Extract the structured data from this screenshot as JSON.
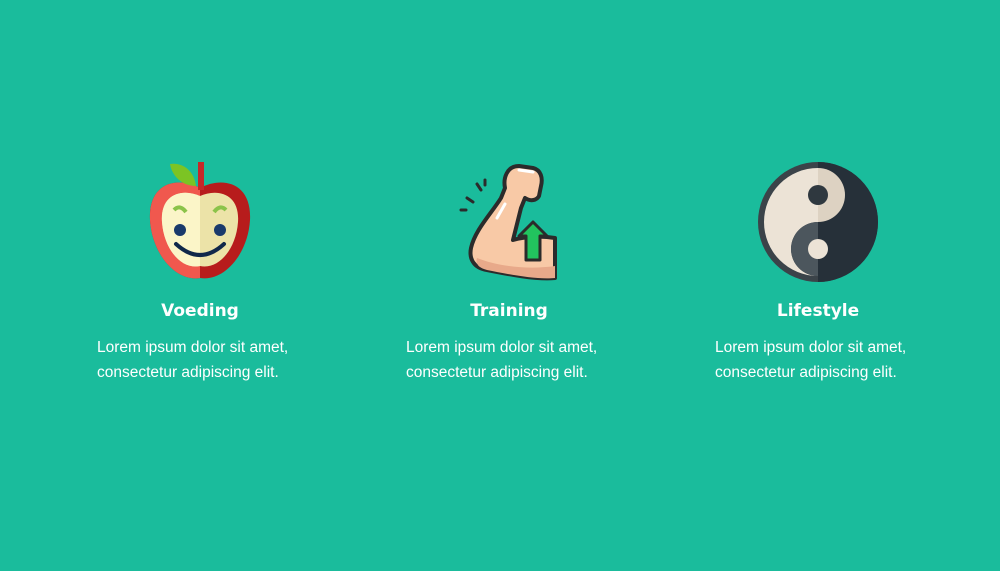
{
  "colors": {
    "background": "#1abc9c"
  },
  "features": [
    {
      "icon": "apple-smiley-icon",
      "title": "Voeding",
      "line1": "Lorem ipsum dolor sit amet,",
      "line2": "consectetur adipiscing elit."
    },
    {
      "icon": "flexed-arm-arrow-up-icon",
      "title": "Training",
      "line1": "Lorem ipsum dolor sit amet,",
      "line2": "consectetur adipiscing elit."
    },
    {
      "icon": "yin-yang-icon",
      "title": "Lifestyle",
      "line1": "Lorem ipsum dolor sit amet,",
      "line2": "consectetur adipiscing elit."
    }
  ]
}
